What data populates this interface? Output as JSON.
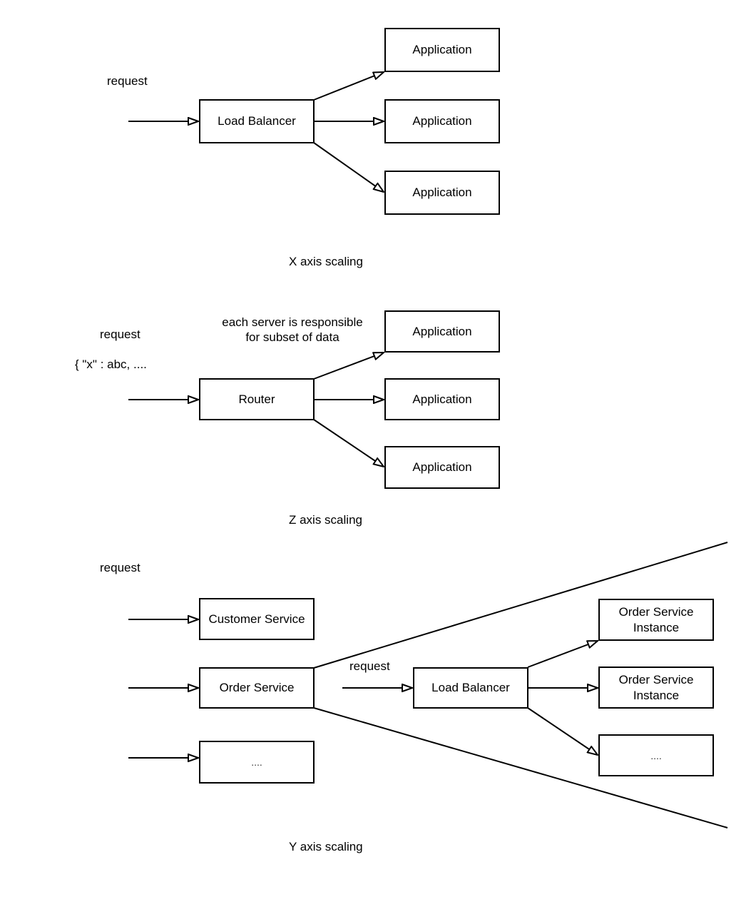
{
  "x_axis": {
    "caption": "X axis scaling",
    "request_label": "request",
    "dispatcher": "Load Balancer",
    "targets": [
      "Application",
      "Application",
      "Application"
    ]
  },
  "z_axis": {
    "caption": "Z axis scaling",
    "request_label": "request",
    "request_payload": "{ \"x\" : abc, ....",
    "note": "each server is responsible\nfor subset of data",
    "dispatcher": "Router",
    "targets": [
      "Application",
      "Application",
      "Application"
    ]
  },
  "y_axis": {
    "caption": "Y axis scaling",
    "request_label": "request",
    "services": [
      "Customer Service",
      "Order Service",
      "...."
    ],
    "zoom_detail": {
      "request_label": "request",
      "dispatcher": "Load Balancer",
      "targets": [
        "Order Service\nInstance",
        "Order Service\nInstance",
        "...."
      ]
    }
  },
  "style": {
    "stroke": "#000000",
    "background": "#ffffff"
  }
}
